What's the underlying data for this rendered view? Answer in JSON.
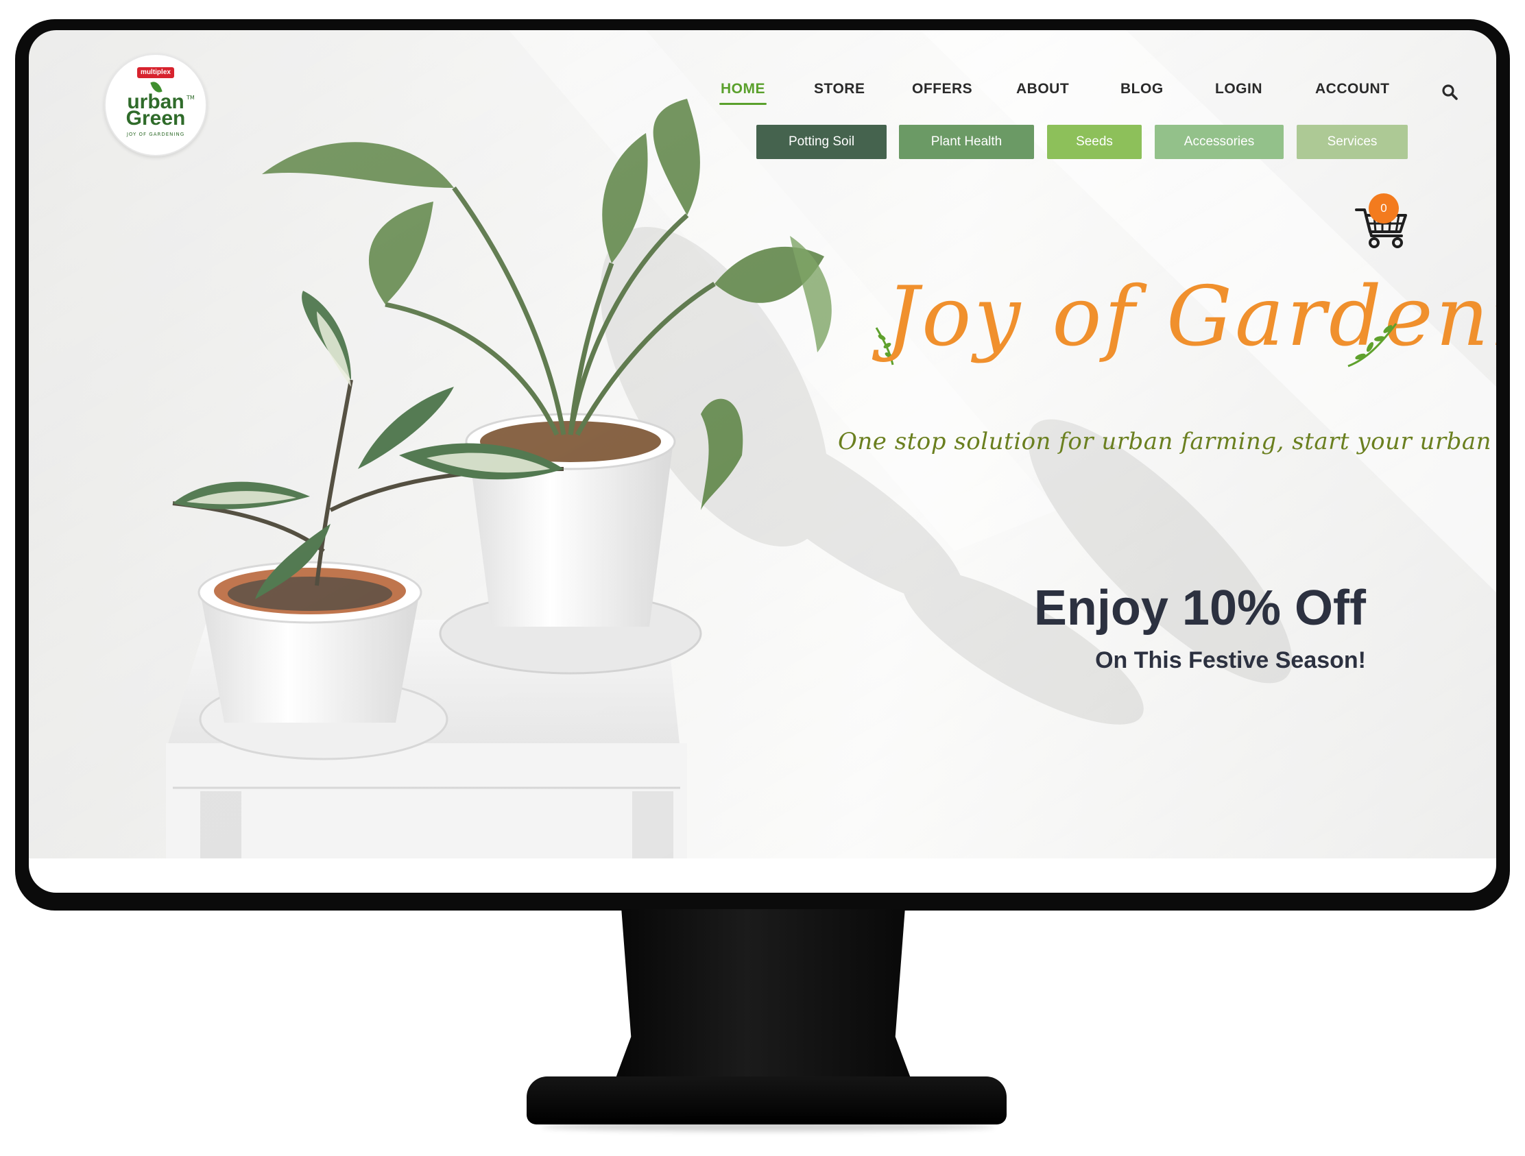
{
  "brand": {
    "logo_badge": "multiplex",
    "logo_line1": "urban",
    "logo_line2": "Green",
    "logo_tm": "TM",
    "logo_tagline": "JOY OF GARDENING"
  },
  "nav": {
    "items": [
      {
        "label": "HOME",
        "active": true
      },
      {
        "label": "STORE",
        "active": false
      },
      {
        "label": "OFFERS",
        "active": false
      },
      {
        "label": "ABOUT",
        "active": false
      },
      {
        "label": "BLOG",
        "active": false
      },
      {
        "label": "LOGIN",
        "active": false
      },
      {
        "label": "ACCOUNT",
        "active": false
      }
    ],
    "search_icon": "search-icon",
    "active_color": "#5aa02c"
  },
  "categories": [
    {
      "label": "Potting Soil",
      "color": "#45634e"
    },
    {
      "label": "Plant Health",
      "color": "#6b9a65"
    },
    {
      "label": "Seeds",
      "color": "#8dc05a"
    },
    {
      "label": "Accessories",
      "color": "#93c18a"
    },
    {
      "label": "Services",
      "color": "#adc995"
    }
  ],
  "cart": {
    "count": "0",
    "icon": "cart-icon",
    "badge_color": "#f37b1e"
  },
  "hero": {
    "title": "Joy of Gardening",
    "tagline": "One stop solution for urban farming, start your urban farm today!",
    "title_color": "#f0902d",
    "tagline_color": "#6a7f1f"
  },
  "offer": {
    "title": "Enjoy 10% Off",
    "subtitle": "On This Festive Season!"
  }
}
